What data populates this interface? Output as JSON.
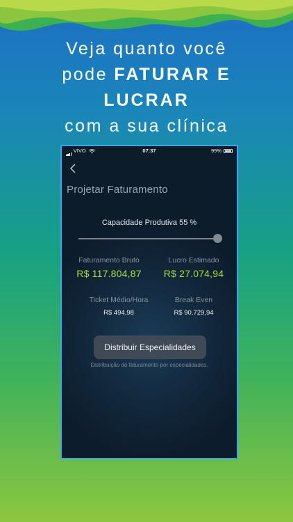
{
  "headline": {
    "line1": "Veja quanto você",
    "line2_prefix": "pode ",
    "line2_bold": "FATURAR E",
    "line3_bold": "LUCRAR",
    "line4": "com a sua clínica"
  },
  "colors": {
    "accent_green": "#a8de3f",
    "phone_border": "#36a6f2",
    "button_bg": "#3f4a56"
  },
  "status_bar": {
    "carrier": "VIVO",
    "time": "07:37",
    "battery": "99%"
  },
  "screen": {
    "title": "Projetar Faturamento",
    "back_icon": "chevron-left-icon",
    "capacity_label": "Capacidade Produtiva 55 %",
    "capacity_level": 0.55,
    "metrics": {
      "gross_label": "Faturamento Bruto",
      "gross_value": "R$ 117.804,87",
      "profit_label": "Lucro Estimado",
      "profit_value": "R$ 27.074,94",
      "ticket_label": "Ticket Médio/Hora",
      "ticket_value": "R$ 494,98",
      "break_label": "Break Even",
      "break_value": "R$ 90.729,94"
    },
    "distribute_button": "Distribuir Especialidades",
    "distribute_caption": "Distribuição do faturamento por especialidades."
  }
}
